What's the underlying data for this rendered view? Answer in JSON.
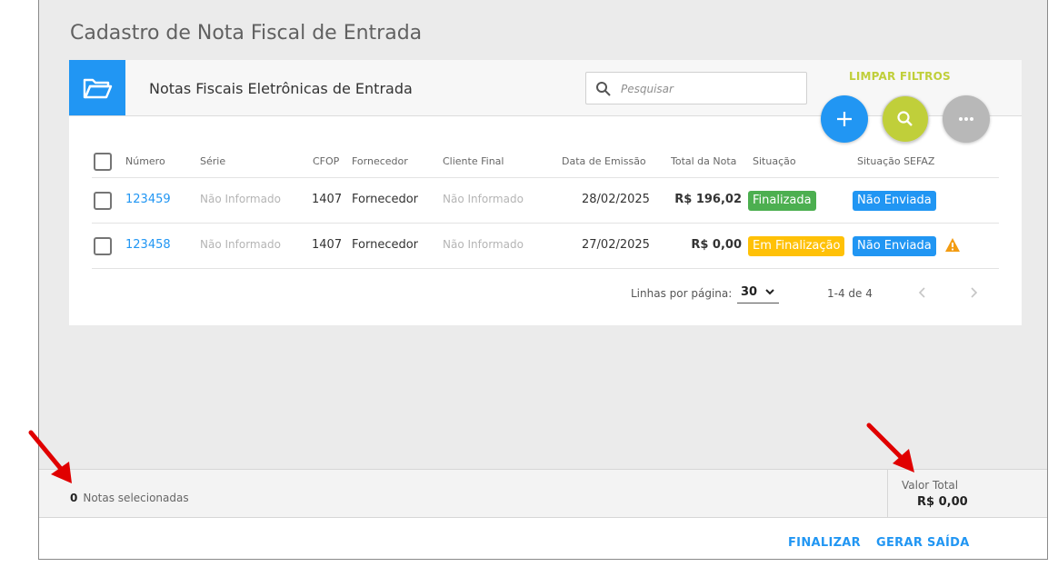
{
  "page": {
    "title": "Cadastro de Nota Fiscal de Entrada"
  },
  "card": {
    "title": "Notas Fiscais Eletrônicas de Entrada",
    "search_placeholder": "Pesquisar",
    "clear_filters": "LIMPAR FILTROS",
    "icons": [
      "folder-icon",
      "search-icon",
      "plus-icon",
      "search-icon",
      "more-icon"
    ]
  },
  "table": {
    "headers": [
      "Número",
      "Série",
      "CFOP",
      "Fornecedor",
      "Cliente Final",
      "Data de Emissão",
      "Total da Nota",
      "Situação",
      "Situação SEFAZ"
    ],
    "rows": [
      {
        "numero": "123459",
        "serie": "Não Informado",
        "cfop": "1407",
        "fornecedor": "Fornecedor",
        "cliente": "Não Informado",
        "data": "28/02/2025",
        "total": "R$ 196,02",
        "situacao": "Finalizada",
        "sefaz": "Não Enviada",
        "warning": false
      },
      {
        "numero": "123458",
        "serie": "Não Informado",
        "cfop": "1407",
        "fornecedor": "Fornecedor",
        "cliente": "Não Informado",
        "data": "27/02/2025",
        "total": "R$ 0,00",
        "situacao": "Em Finalização",
        "sefaz": "Não Enviada",
        "warning": true
      }
    ]
  },
  "pagination": {
    "rows_label": "Linhas por página:",
    "rows_value": "30",
    "range": "1-4 de 4"
  },
  "footer": {
    "selected_count": "0",
    "selected_label": "Notas selecionadas",
    "total_label": "Valor Total",
    "total_value": "R$ 0,00"
  },
  "actions": {
    "finalize": "FINALIZAR",
    "generate_exit": "GERAR SAÍDA"
  },
  "colors": {
    "primary": "#2196f3",
    "accent": "#c0cf3a",
    "success": "#4caf50",
    "warning": "#ffc107",
    "annotation": "#e00000"
  }
}
